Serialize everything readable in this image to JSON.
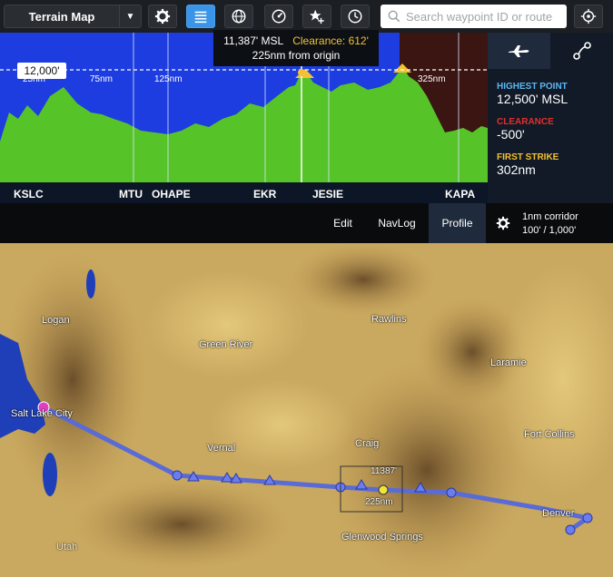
{
  "toolbar": {
    "map_type": "Terrain Map",
    "search_placeholder": "Search waypoint ID or route",
    "buttons": [
      "settings-icon",
      "layers-icon",
      "globe-icon",
      "gauge-icon",
      "star-plus-icon",
      "clock-icon",
      "crosshair-icon"
    ]
  },
  "profile": {
    "distance_ticks": [
      "25nm",
      "75nm",
      "125nm",
      "325nm"
    ],
    "tooltip": {
      "altitude": "11,387' MSL",
      "clearance": "Clearance: 612'",
      "distance": "225nm from origin"
    },
    "altitude_setting": "12,000'",
    "waypoints": [
      "KSLC",
      "MTU",
      "OHAPE",
      "EKR",
      "JESIE",
      "KAPA"
    ]
  },
  "side_panel": {
    "stats": [
      {
        "label": "HIGHEST POINT",
        "value": "12,500' MSL",
        "color": "#5bb7f0"
      },
      {
        "label": "CLEARANCE",
        "value": "-500'",
        "color": "#e0302c"
      },
      {
        "label": "FIRST STRIKE",
        "value": "302nm",
        "color": "#f2c232"
      }
    ]
  },
  "actions": {
    "edit": "Edit",
    "navlog": "NavLog",
    "profile": "Profile",
    "corridor_line1": "1nm corridor",
    "corridor_line2": "100' / 1,000'"
  },
  "map": {
    "cities": [
      "Logan",
      "Rawlins",
      "Green River",
      "Laramie",
      "Salt Lake City",
      "Fort Collins",
      "Vernal",
      "Craig",
      "Denver",
      "Glenwood Springs",
      "Utah"
    ],
    "route_marker": {
      "altitude": "11387'",
      "distance": "225nm"
    }
  }
}
